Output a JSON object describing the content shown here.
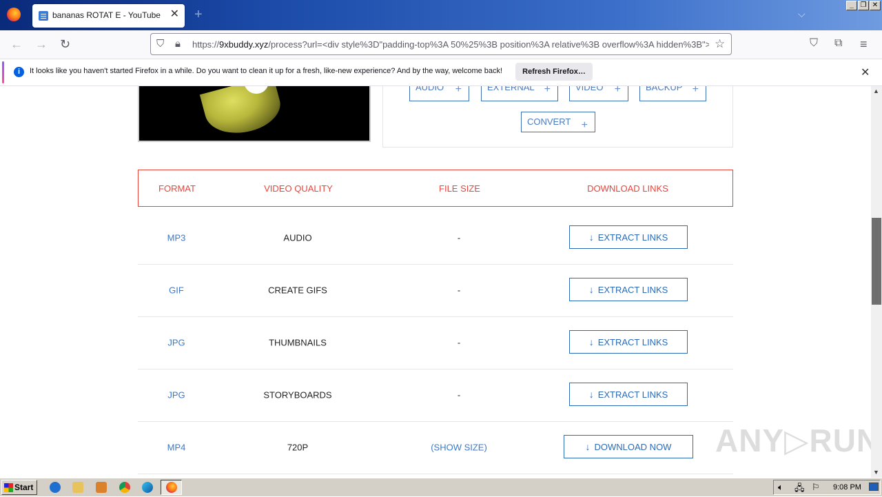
{
  "browser": {
    "tab_title": "bananas ROTAT E - YouTube",
    "tab_close": "✕",
    "new_tab": "+",
    "url_prefix": "https://",
    "url_domain": "9xbuddy.xyz",
    "url_rest": "/process?url=<div style%3D\"padding-top%3A 50%25%3B position%3A relative%3B overflow%3A hidden%3B\">",
    "notification_text": "It looks like you haven't started Firefox in a while. Do you want to clean it up for a fresh, like-new experience? And by the way, welcome back!",
    "notification_button": "Refresh Firefox…",
    "window_buttons": [
      "_",
      "❐",
      "✕"
    ]
  },
  "page": {
    "source_buttons": [
      "AUDIO",
      "EXTERNAL",
      "VIDEO",
      "BACKUP",
      "CONVERT"
    ],
    "table_headers": [
      "FORMAT",
      "VIDEO QUALITY",
      "FILE SIZE",
      "DOWNLOAD LINKS"
    ],
    "rows": [
      {
        "format": "MP3",
        "quality": "AUDIO",
        "size": "-",
        "action": "EXTRACT LINKS"
      },
      {
        "format": "GIF",
        "quality": "CREATE GIFS",
        "size": "-",
        "action": "EXTRACT LINKS"
      },
      {
        "format": "JPG",
        "quality": "THUMBNAILS",
        "size": "-",
        "action": "EXTRACT LINKS"
      },
      {
        "format": "JPG",
        "quality": "STORYBOARDS",
        "size": "-",
        "action": "EXTRACT LINKS"
      },
      {
        "format": "MP4",
        "quality": "720P",
        "size": "(SHOW SIZE)",
        "action": "DOWNLOAD NOW"
      }
    ],
    "watermark": "ANY▷RUN"
  },
  "taskbar": {
    "start_label": "Start",
    "clock": "9:08 PM"
  },
  "colors": {
    "accent_blue": "#3a78c9",
    "header_red": "#e8443a"
  }
}
